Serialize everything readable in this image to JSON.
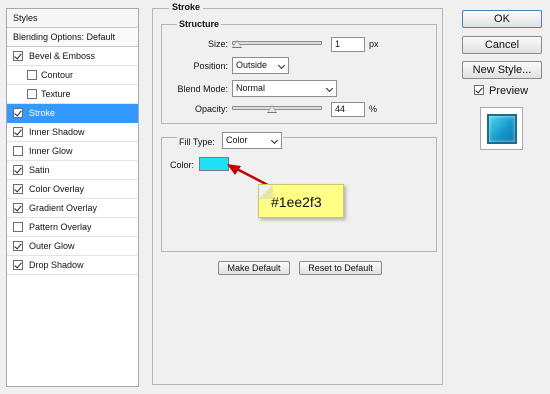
{
  "styles_panel": {
    "header": "Styles",
    "blending": "Blending Options: Default",
    "items": [
      {
        "label": "Bevel & Emboss",
        "checked": true,
        "indent": false,
        "selected": false
      },
      {
        "label": "Contour",
        "checked": false,
        "indent": true,
        "selected": false
      },
      {
        "label": "Texture",
        "checked": false,
        "indent": true,
        "selected": false
      },
      {
        "label": "Stroke",
        "checked": true,
        "indent": false,
        "selected": true
      },
      {
        "label": "Inner Shadow",
        "checked": true,
        "indent": false,
        "selected": false
      },
      {
        "label": "Inner Glow",
        "checked": false,
        "indent": false,
        "selected": false
      },
      {
        "label": "Satin",
        "checked": true,
        "indent": false,
        "selected": false
      },
      {
        "label": "Color Overlay",
        "checked": true,
        "indent": false,
        "selected": false
      },
      {
        "label": "Gradient Overlay",
        "checked": true,
        "indent": false,
        "selected": false
      },
      {
        "label": "Pattern Overlay",
        "checked": false,
        "indent": false,
        "selected": false
      },
      {
        "label": "Outer Glow",
        "checked": true,
        "indent": false,
        "selected": false
      },
      {
        "label": "Drop Shadow",
        "checked": true,
        "indent": false,
        "selected": false
      }
    ]
  },
  "stroke": {
    "title": "Stroke",
    "structure_title": "Structure",
    "size_label": "Size:",
    "size_value": "1",
    "size_unit": "px",
    "size_slider": 0.0,
    "position_label": "Position:",
    "position_value": "Outside",
    "blend_label": "Blend Mode:",
    "blend_value": "Normal",
    "opacity_label": "Opacity:",
    "opacity_value": "44",
    "opacity_unit": "%",
    "opacity_slider": 0.44,
    "filltype_label": "Fill Type:",
    "filltype_value": "Color",
    "color_label": "Color:",
    "color_swatch": "#1ee2f3",
    "make_default": "Make Default",
    "reset_default": "Reset to Default"
  },
  "annotation": {
    "text": "#1ee2f3",
    "arrow_color": "#c00000",
    "note_color": "#ffff88"
  },
  "buttons": {
    "ok": "OK",
    "cancel": "Cancel",
    "new_style": "New Style...",
    "preview_label": "Preview",
    "preview_checked": true
  }
}
